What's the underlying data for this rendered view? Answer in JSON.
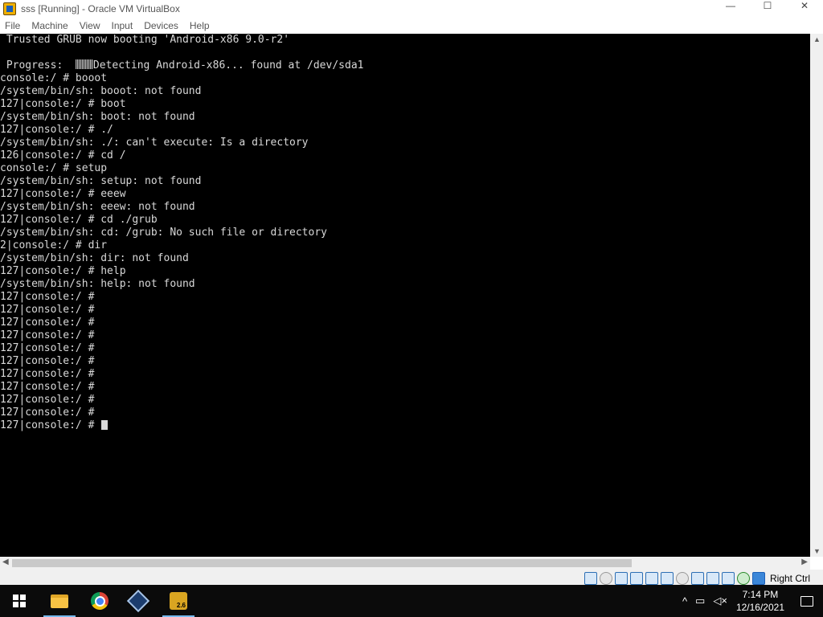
{
  "window": {
    "title": "sss [Running] - Oracle VM VirtualBox",
    "minimize_glyph": "—",
    "maximize_glyph": "☐",
    "close_glyph": "✕"
  },
  "menu": {
    "file": "File",
    "machine": "Machine",
    "view": "View",
    "input": "Input",
    "devices": "Devices",
    "help": "Help"
  },
  "console": {
    "line_01": " Trusted GRUB now booting 'Android-x86 9.0-r2'",
    "line_02": "",
    "line_03_prefix": " Progress:  ",
    "line_03_suffix": "Detecting Android-x86... found at /dev/sda1",
    "lines": [
      "console:/ # booot",
      "/system/bin/sh: booot: not found",
      "127|console:/ # boot",
      "/system/bin/sh: boot: not found",
      "127|console:/ # ./",
      "/system/bin/sh: ./: can't execute: Is a directory",
      "126|console:/ # cd /",
      "console:/ # setup",
      "/system/bin/sh: setup: not found",
      "127|console:/ # eeew",
      "/system/bin/sh: eeew: not found",
      "127|console:/ # cd ./grub",
      "/system/bin/sh: cd: /grub: No such file or directory",
      "2|console:/ # dir",
      "/system/bin/sh: dir: not found",
      "127|console:/ # help",
      "/system/bin/sh: help: not found",
      "127|console:/ #",
      "127|console:/ #",
      "127|console:/ #",
      "127|console:/ #",
      "127|console:/ #",
      "127|console:/ #",
      "127|console:/ #",
      "127|console:/ #",
      "127|console:/ #",
      "127|console:/ #"
    ],
    "prompt_last": "127|console:/ # "
  },
  "statusbar": {
    "host_key": "Right Ctrl",
    "icons": [
      "hard-disk-icon",
      "optical-drive-icon",
      "audio-icon",
      "network-icon",
      "usb-icon",
      "shared-folders-icon",
      "display-icon",
      "video-capture-icon",
      "recording-icon",
      "cpu-icon",
      "mouse-integration-icon",
      "keyboard-capture-icon"
    ]
  },
  "taskbar": {
    "clock_time": "7:14 PM",
    "clock_date": "12/16/2021",
    "vm_badge": "2.6",
    "tray_chevron": "^"
  }
}
